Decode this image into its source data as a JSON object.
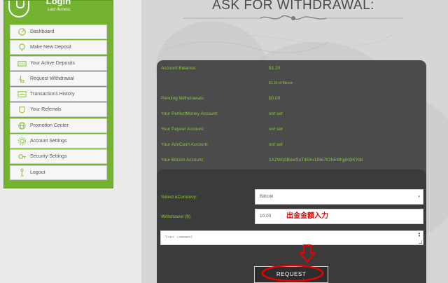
{
  "sidebar": {
    "username": "Login",
    "last_access": "Last Access:",
    "items": [
      {
        "label": "Dashboard",
        "icon": "dashboard-icon"
      },
      {
        "label": "Make New Deposit",
        "icon": "deposit-icon"
      },
      {
        "label": "Your Active Deposits",
        "icon": "active-deposits-icon"
      },
      {
        "label": "Request Withdrawal",
        "icon": "withdrawal-icon"
      },
      {
        "label": "Transactions History",
        "icon": "history-icon"
      },
      {
        "label": "Your Referrals",
        "icon": "referrals-icon"
      },
      {
        "label": "Promotion Center",
        "icon": "promotion-icon"
      },
      {
        "label": "Account Settings",
        "icon": "account-settings-icon"
      },
      {
        "label": "Security Settings",
        "icon": "security-icon"
      },
      {
        "label": "Logout",
        "icon": "logout-icon"
      }
    ]
  },
  "heading": "ASK FOR WITHDRAWAL:",
  "account": {
    "balance_label": "Account Balance:",
    "balance_value": "$1.20",
    "balance_btc": "$1.20 of Bitcoin",
    "pending_label": "Pending Withdrawals:",
    "pending_value": "$0.00",
    "perfectmoney_label": "Your PerfectMoney Account:",
    "perfectmoney_value": "not set",
    "payeer_label": "Your Payeer Account:",
    "payeer_value": "not set",
    "advcash_label": "Your AdvCash Account:",
    "advcash_value": "not set",
    "bitcoin_label": "Your Bitcoin Account:",
    "bitcoin_value": "1A2WqSBewSoT4EKcUB67tDhEMhjpKBKYob"
  },
  "form": {
    "ecurrency_label": "Select eCurrency:",
    "ecurrency_selected": "Bitcoin",
    "amount_label": "Withdrawal ($):",
    "amount_value": "10.00",
    "annotation": "出金金額入力",
    "comment_placeholder": "Your comment",
    "request_button": "REQUEST"
  },
  "colors": {
    "sidebar_green": "#73b330",
    "label_green": "#8cc63e",
    "annotation_red": "#e60000"
  }
}
